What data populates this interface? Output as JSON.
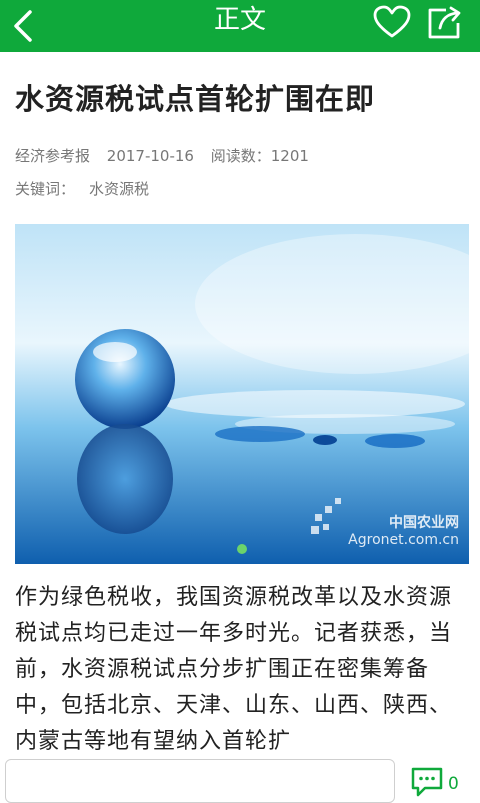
{
  "header": {
    "title": "正文",
    "back_icon": "chevron-left-icon",
    "favorite_icon": "heart-icon",
    "share_icon": "share-icon",
    "bar_color": "#0fa93b"
  },
  "article": {
    "headline": "水资源税试点首轮扩围在即",
    "source": "经济参考报",
    "date": "2017-10-16",
    "read_label": "阅读数：1201",
    "keywords_label": "关键词：",
    "keyword": "水资源税",
    "image_watermark_cn": "中国农业网",
    "image_watermark_en": "Agronet.com.cn",
    "body": "作为绿色税收，我国资源税改革以及水资源税试点均已走过一年多时光。记者获悉，当前，水资源税试点分步扩围正在密集筹备中，包括北京、天津、山东、山西、陕西、内蒙古等地有望纳入首轮扩"
  },
  "footer": {
    "comment_placeholder": "",
    "comment_icon": "comment-icon",
    "comment_count": "0"
  }
}
